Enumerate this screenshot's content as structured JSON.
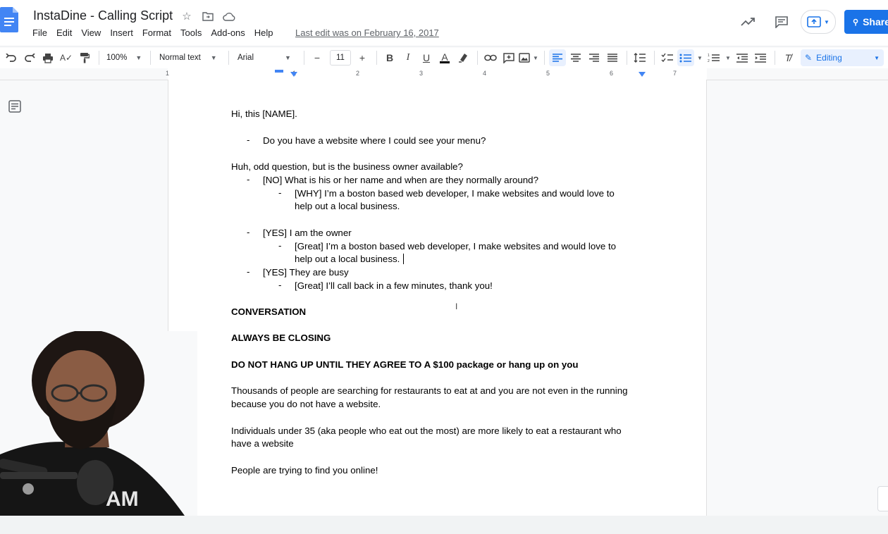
{
  "app": {
    "doc_title": "InstaDine - Calling Script",
    "menu": [
      "File",
      "Edit",
      "View",
      "Insert",
      "Format",
      "Tools",
      "Add-ons",
      "Help"
    ],
    "last_edit": "Last edit was on February 16, 2017",
    "share_label": "Share"
  },
  "toolbar": {
    "zoom": "100%",
    "style": "Normal text",
    "font": "Arial",
    "font_size": "11",
    "minus": "−",
    "plus": "+",
    "editing_label": "Editing"
  },
  "ruler": {
    "numbers": [
      "1",
      "1",
      "2",
      "3",
      "4",
      "5",
      "6",
      "7"
    ]
  },
  "doc": {
    "l1": "Hi, this [NAME].",
    "l2": "Do you have a website where I could see your menu?",
    "l3": "Huh, odd question, but is the business owner available?",
    "l4": "[NO] What is his or her name and when are they normally around?",
    "l5": "[WHY] I’m a boston based web developer, I make websites and would love to",
    "l6": "help out a local business.",
    "l7": "[YES] I am the owner",
    "l8": "[Great]  I’m a boston based web developer, I make websites and would love to",
    "l9": "help out a local business.",
    "l10": "[YES] They are busy",
    "l11": "[Great] I’ll call back in a few minutes, thank you!",
    "l12": "CONVERSATION",
    "l13": "ALWAYS BE CLOSING",
    "l14": "DO NOT HANG UP UNTIL THEY AGREE TO A $100 package or hang up on you",
    "l15": "Thousands of people are searching for restaurants to eat at and you are not even in the running",
    "l16": "because you do not have a website.",
    "l17": "Individuals under 35 (aka people who eat out the most) are more likely to eat a restaurant who",
    "l18": "have a website",
    "l19": "People are trying to find you online!",
    "bullet": "-"
  },
  "webcam": {
    "shirt_text": "AM"
  },
  "colors": {
    "accent": "#1a73e8",
    "share_bg": "#1a73e8"
  }
}
